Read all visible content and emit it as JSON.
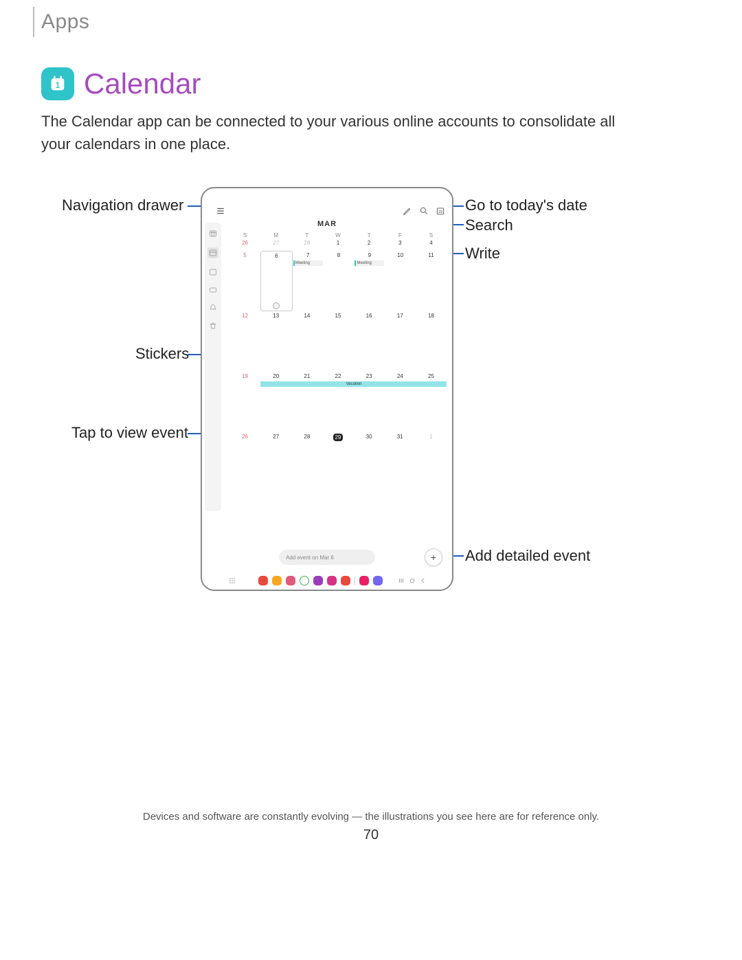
{
  "header": {
    "section": "Apps"
  },
  "title": "Calendar",
  "intro": "The Calendar app can be connected to your various online accounts to consolidate all your calendars in one place.",
  "callouts": {
    "nav_drawer": "Navigation drawer",
    "stickers": "Stickers",
    "tap_event": "Tap to view event",
    "today": "Go to today's date",
    "search": "Search",
    "write": "Write",
    "add_detailed": "Add detailed event"
  },
  "calendar": {
    "month": "MAR",
    "day_headers": [
      "S",
      "M",
      "T",
      "W",
      "T",
      "F",
      "S"
    ],
    "weeks": [
      [
        {
          "n": "26",
          "dim": true,
          "sun": true
        },
        {
          "n": "27",
          "dim": true
        },
        {
          "n": "28",
          "dim": true
        },
        {
          "n": "1"
        },
        {
          "n": "2"
        },
        {
          "n": "3"
        },
        {
          "n": "4"
        }
      ],
      [
        {
          "n": "5",
          "sun": true
        },
        {
          "n": "6",
          "selected": true,
          "sticker": true
        },
        {
          "n": "7",
          "event": "Meeting"
        },
        {
          "n": "8"
        },
        {
          "n": "9",
          "event": "Meeting"
        },
        {
          "n": "10"
        },
        {
          "n": "11"
        }
      ],
      [
        {
          "n": "12",
          "sun": true
        },
        {
          "n": "13"
        },
        {
          "n": "14"
        },
        {
          "n": "15"
        },
        {
          "n": "16"
        },
        {
          "n": "17"
        },
        {
          "n": "18"
        }
      ],
      [
        {
          "n": "19",
          "sun": true
        },
        {
          "n": "20",
          "vac_start": true
        },
        {
          "n": "21"
        },
        {
          "n": "22",
          "vac_label": "Vacation"
        },
        {
          "n": "23"
        },
        {
          "n": "24"
        },
        {
          "n": "25",
          "vac_end": true
        }
      ],
      [
        {
          "n": "26",
          "sun": true
        },
        {
          "n": "27"
        },
        {
          "n": "28"
        },
        {
          "n": "29",
          "today": true
        },
        {
          "n": "30"
        },
        {
          "n": "31"
        },
        {
          "n": "1",
          "dim": true
        }
      ]
    ],
    "quick_add": "Add event on Mar 6",
    "fab": "+"
  },
  "footer": {
    "disclaimer": "Devices and software are constantly evolving — the illustrations you see here are for reference only.",
    "page": "70"
  }
}
